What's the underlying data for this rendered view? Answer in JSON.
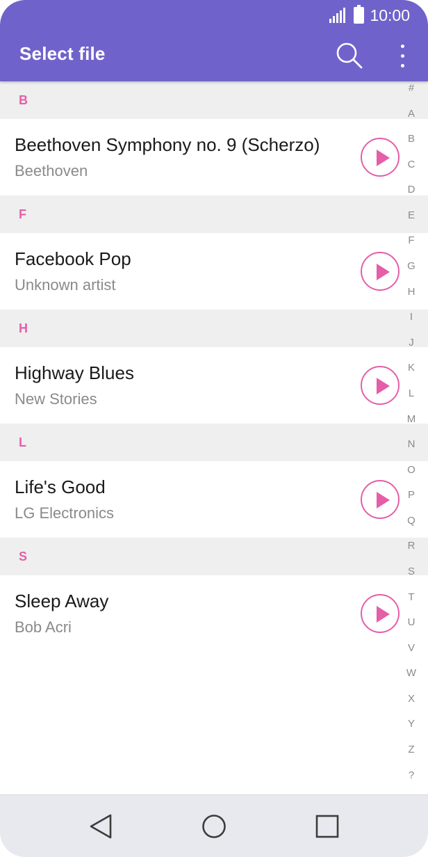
{
  "status": {
    "time": "10:00"
  },
  "header": {
    "title": "Select file",
    "search_icon": "search-icon",
    "more_icon": "more-vert-icon"
  },
  "colors": {
    "header": "#6f63cb",
    "accent": "#e55ea8",
    "section_bg": "#efefef",
    "navbar": "#e8e9ee"
  },
  "sections": [
    {
      "letter": "B",
      "items": [
        {
          "title": "Beethoven Symphony no. 9 (Scherzo)",
          "artist": "Beethoven"
        }
      ]
    },
    {
      "letter": "F",
      "items": [
        {
          "title": "Facebook Pop",
          "artist": "Unknown artist"
        }
      ]
    },
    {
      "letter": "H",
      "items": [
        {
          "title": "Highway Blues",
          "artist": "New Stories"
        }
      ]
    },
    {
      "letter": "L",
      "items": [
        {
          "title": "Life's Good",
          "artist": "LG Electronics"
        }
      ]
    },
    {
      "letter": "S",
      "items": [
        {
          "title": "Sleep Away",
          "artist": "Bob Acri"
        }
      ]
    }
  ],
  "index_letters": [
    "#",
    "A",
    "B",
    "C",
    "D",
    "E",
    "F",
    "G",
    "H",
    "I",
    "J",
    "K",
    "L",
    "M",
    "N",
    "O",
    "P",
    "Q",
    "R",
    "S",
    "T",
    "U",
    "V",
    "W",
    "X",
    "Y",
    "Z",
    "?"
  ],
  "navbar": {
    "back_icon": "back-icon",
    "home_icon": "home-icon",
    "recent_icon": "recent-apps-icon"
  }
}
